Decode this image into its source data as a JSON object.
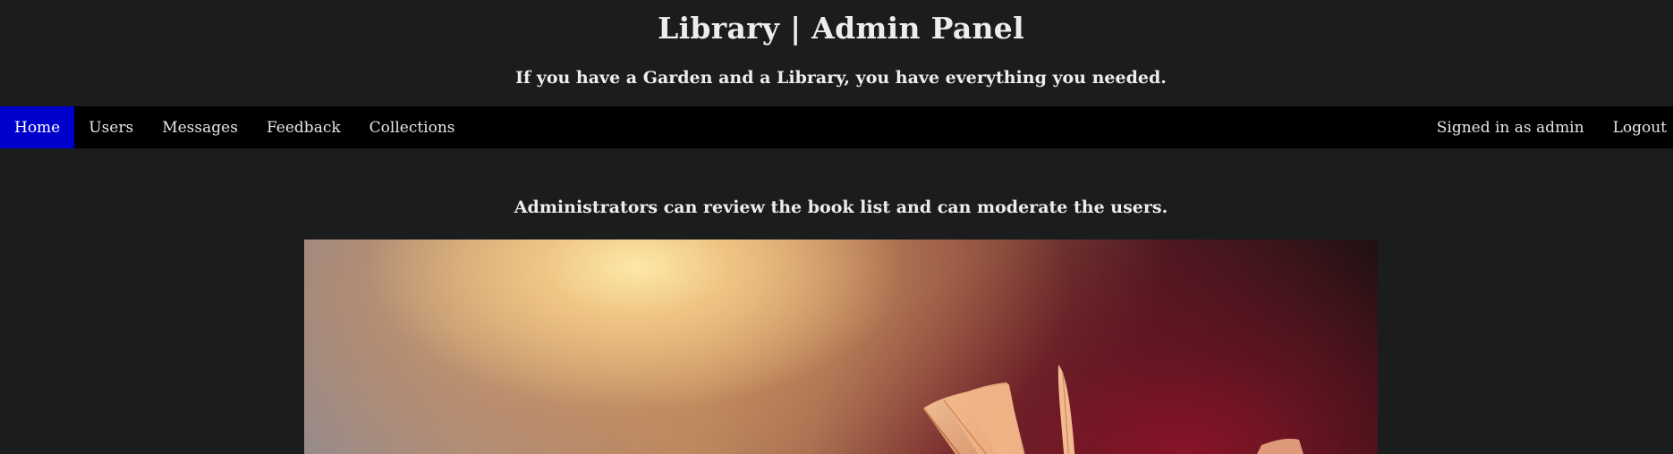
{
  "header": {
    "title": "Library | Admin Panel",
    "subtitle": "If you have a Garden and a Library, you have everything you needed."
  },
  "nav": {
    "items": [
      {
        "label": "Home",
        "active": true
      },
      {
        "label": "Users",
        "active": false
      },
      {
        "label": "Messages",
        "active": false
      },
      {
        "label": "Feedback",
        "active": false
      },
      {
        "label": "Collections",
        "active": false
      }
    ],
    "signed_in": "Signed in as admin",
    "logout": "Logout"
  },
  "main": {
    "intro": "Administrators can review the book list and can moderate the users."
  },
  "colors": {
    "background": "#1b1c1e",
    "navbar": "#000000",
    "nav_active": "#0000cd",
    "text": "#ededed"
  }
}
